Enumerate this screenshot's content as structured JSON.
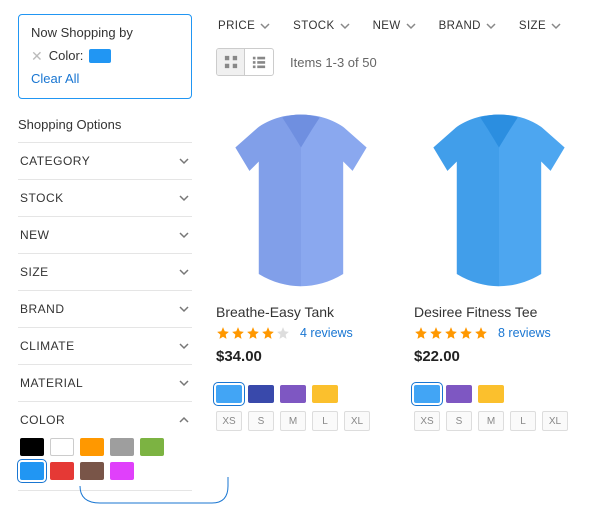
{
  "now_shopping": {
    "title": "Now Shopping by",
    "filter_label": "Color:",
    "filter_swatch_color": "#2196f3",
    "clear_all": "Clear All"
  },
  "shopping_options_title": "Shopping Options",
  "facets": [
    {
      "label": "CATEGORY",
      "expanded": false
    },
    {
      "label": "STOCK",
      "expanded": false
    },
    {
      "label": "NEW",
      "expanded": false
    },
    {
      "label": "SIZE",
      "expanded": false
    },
    {
      "label": "BRAND",
      "expanded": false
    },
    {
      "label": "CLIMATE",
      "expanded": false
    },
    {
      "label": "MATERIAL",
      "expanded": false
    },
    {
      "label": "COLOR",
      "expanded": true
    }
  ],
  "color_swatches": [
    {
      "color": "#000000"
    },
    {
      "color": "#ffffff",
      "white": true
    },
    {
      "color": "#ff9800"
    },
    {
      "color": "#9e9e9e"
    },
    {
      "color": "#7cb342"
    },
    {
      "color": "#2196f3",
      "selected": true
    },
    {
      "color": "#e53935"
    },
    {
      "color": "#795548"
    },
    {
      "color": "#e040fb"
    }
  ],
  "top_filters": [
    {
      "label": "PRICE"
    },
    {
      "label": "STOCK"
    },
    {
      "label": "NEW"
    },
    {
      "label": "BRAND"
    },
    {
      "label": "SIZE"
    }
  ],
  "toolbar": {
    "items_text": "Items 1-3 of 50"
  },
  "products": [
    {
      "name": "Breathe-Easy Tank",
      "rating": 4,
      "reviews_link": "4 reviews",
      "price": "$34.00",
      "image_color": "#8aa8ef",
      "image_shade": "#6f8fe0",
      "colors": [
        {
          "c": "#42a5f5",
          "selected": true
        },
        {
          "c": "#3949ab"
        },
        {
          "c": "#7e57c2"
        },
        {
          "c": "#fbc02d"
        }
      ],
      "sizes": [
        "XS",
        "S",
        "M",
        "L",
        "XL"
      ]
    },
    {
      "name": "Desiree Fitness Tee",
      "rating": 5,
      "reviews_link": "8 reviews",
      "price": "$22.00",
      "image_color": "#4da6f0",
      "image_shade": "#2b8ee0",
      "colors": [
        {
          "c": "#42a5f5",
          "selected": true
        },
        {
          "c": "#7e57c2"
        },
        {
          "c": "#fbc02d"
        }
      ],
      "sizes": [
        "XS",
        "S",
        "M",
        "L",
        "XL"
      ]
    }
  ]
}
